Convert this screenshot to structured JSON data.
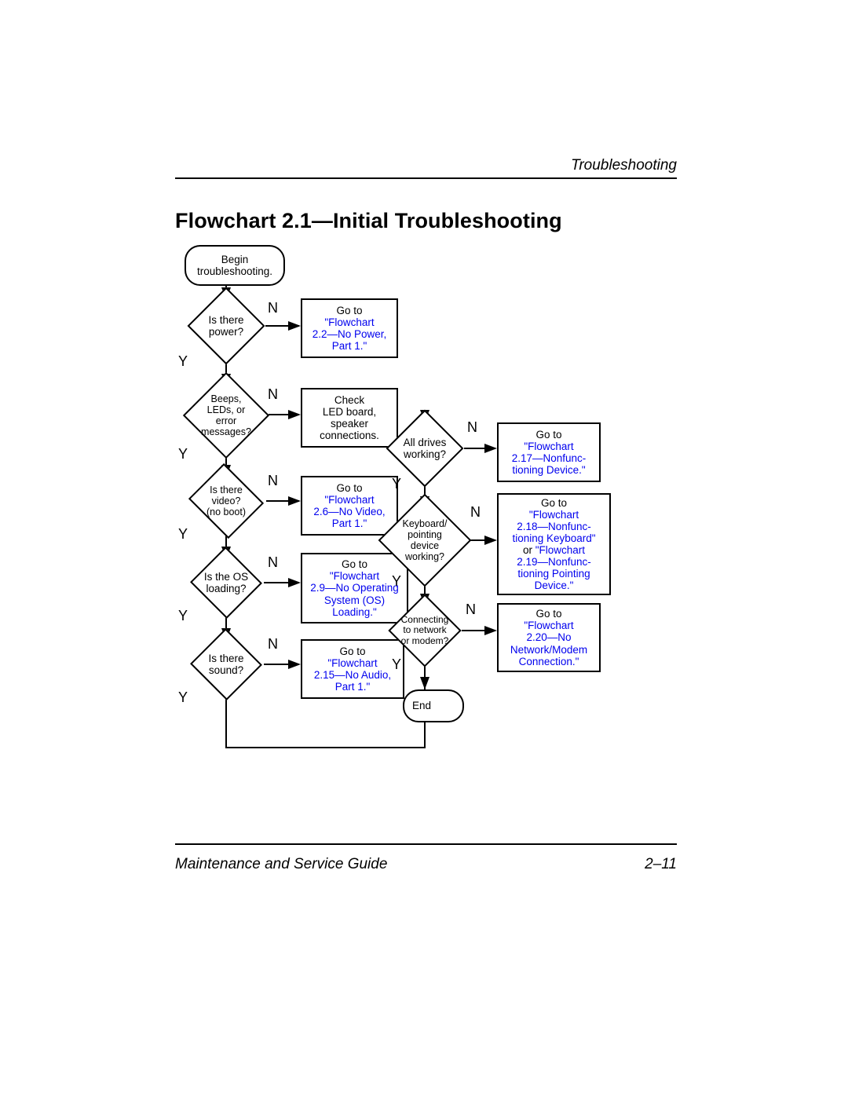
{
  "header": {
    "right": "Troubleshooting"
  },
  "title": "Flowchart 2.1—Initial Troubleshooting",
  "footer": {
    "left": "Maintenance and Service Guide",
    "right": "2–11"
  },
  "yn": {
    "Y": "Y",
    "N": "N"
  },
  "nodes": {
    "begin": "Begin\ntroubleshooting.",
    "power": "Is there\npower?",
    "beeps": "Beeps,\nLEDs, or error\nmessages?",
    "video": "Is there video?\n(no boot)",
    "os": "Is the OS\nloading?",
    "sound": "Is there\nsound?",
    "drives": "All drives\nworking?",
    "kb": "Keyboard/\npointing\ndevice\nworking?",
    "net": "Connecting\nto network\nor modem?",
    "end": "End",
    "ref_power": {
      "goto": "Go to",
      "link": "\"Flowchart\n2.2—No Power,\nPart 1.\""
    },
    "check_led": "Check\nLED board,\nspeaker\nconnections.",
    "ref_video": {
      "goto": "Go to",
      "link": "\"Flowchart\n2.6—No Video,\nPart 1.\""
    },
    "ref_os": {
      "goto": "Go to",
      "link": "\"Flowchart\n2.9—No Operating\nSystem (OS)\nLoading.\""
    },
    "ref_audio": {
      "goto": "Go to",
      "link": "\"Flowchart\n2.15—No Audio,\nPart 1.\""
    },
    "ref_drives": {
      "goto": "Go to",
      "link": "\"Flowchart\n2.17—Nonfunc-\ntioning Device.\""
    },
    "ref_kb": {
      "goto": "Go to",
      "link1": "\"Flowchart\n2.18—Nonfunc-\ntioning Keyboard\"",
      "mid": "or",
      "link2": "\"Flowchart\n2.19—Nonfunc-\ntioning Pointing\nDevice.\""
    },
    "ref_net": {
      "goto": "Go to",
      "link": "\"Flowchart\n2.20—No\nNetwork/Modem\nConnection.\""
    }
  },
  "chart_data": {
    "type": "flowchart",
    "start": "begin",
    "nodes": [
      {
        "id": "begin",
        "shape": "terminator",
        "text": "Begin troubleshooting."
      },
      {
        "id": "power",
        "shape": "decision",
        "text": "Is there power?"
      },
      {
        "id": "beeps",
        "shape": "decision",
        "text": "Beeps, LEDs, or error messages?"
      },
      {
        "id": "video",
        "shape": "decision",
        "text": "Is there video? (no boot)"
      },
      {
        "id": "os",
        "shape": "decision",
        "text": "Is the OS loading?"
      },
      {
        "id": "sound",
        "shape": "decision",
        "text": "Is there sound?"
      },
      {
        "id": "drives",
        "shape": "decision",
        "text": "All drives working?"
      },
      {
        "id": "kb",
        "shape": "decision",
        "text": "Keyboard/pointing device working?"
      },
      {
        "id": "net",
        "shape": "decision",
        "text": "Connecting to network or modem?"
      },
      {
        "id": "end",
        "shape": "terminator",
        "text": "End"
      },
      {
        "id": "ref_power",
        "shape": "process",
        "text": "Go to \"Flowchart 2.2—No Power, Part 1.\"",
        "link": true
      },
      {
        "id": "check_led",
        "shape": "process",
        "text": "Check LED board, speaker connections."
      },
      {
        "id": "ref_video",
        "shape": "process",
        "text": "Go to \"Flowchart 2.6—No Video, Part 1.\"",
        "link": true
      },
      {
        "id": "ref_os",
        "shape": "process",
        "text": "Go to \"Flowchart 2.9—No Operating System (OS) Loading.\"",
        "link": true
      },
      {
        "id": "ref_audio",
        "shape": "process",
        "text": "Go to \"Flowchart 2.15—No Audio, Part 1.\"",
        "link": true
      },
      {
        "id": "ref_drives",
        "shape": "process",
        "text": "Go to \"Flowchart 2.17—Nonfunctioning Device.\"",
        "link": true
      },
      {
        "id": "ref_kb",
        "shape": "process",
        "text": "Go to \"Flowchart 2.18—Nonfunctioning Keyboard\" or \"Flowchart 2.19—Nonfunctioning Pointing Device.\"",
        "link": true
      },
      {
        "id": "ref_net",
        "shape": "process",
        "text": "Go to \"Flowchart 2.20—No Network/Modem Connection.\"",
        "link": true
      }
    ],
    "edges": [
      {
        "from": "begin",
        "to": "power"
      },
      {
        "from": "power",
        "label": "N",
        "to": "ref_power"
      },
      {
        "from": "power",
        "label": "Y",
        "to": "beeps"
      },
      {
        "from": "beeps",
        "label": "N",
        "to": "check_led"
      },
      {
        "from": "beeps",
        "label": "Y",
        "to": "video"
      },
      {
        "from": "video",
        "label": "N",
        "to": "ref_video"
      },
      {
        "from": "video",
        "label": "Y",
        "to": "os"
      },
      {
        "from": "os",
        "label": "N",
        "to": "ref_os"
      },
      {
        "from": "os",
        "label": "Y",
        "to": "sound"
      },
      {
        "from": "sound",
        "label": "N",
        "to": "ref_audio"
      },
      {
        "from": "sound",
        "label": "Y",
        "to": "drives"
      },
      {
        "from": "drives",
        "label": "N",
        "to": "ref_drives"
      },
      {
        "from": "drives",
        "label": "Y",
        "to": "kb"
      },
      {
        "from": "kb",
        "label": "N",
        "to": "ref_kb"
      },
      {
        "from": "kb",
        "label": "Y",
        "to": "net"
      },
      {
        "from": "net",
        "label": "N",
        "to": "ref_net"
      },
      {
        "from": "net",
        "label": "Y",
        "to": "end"
      }
    ]
  }
}
